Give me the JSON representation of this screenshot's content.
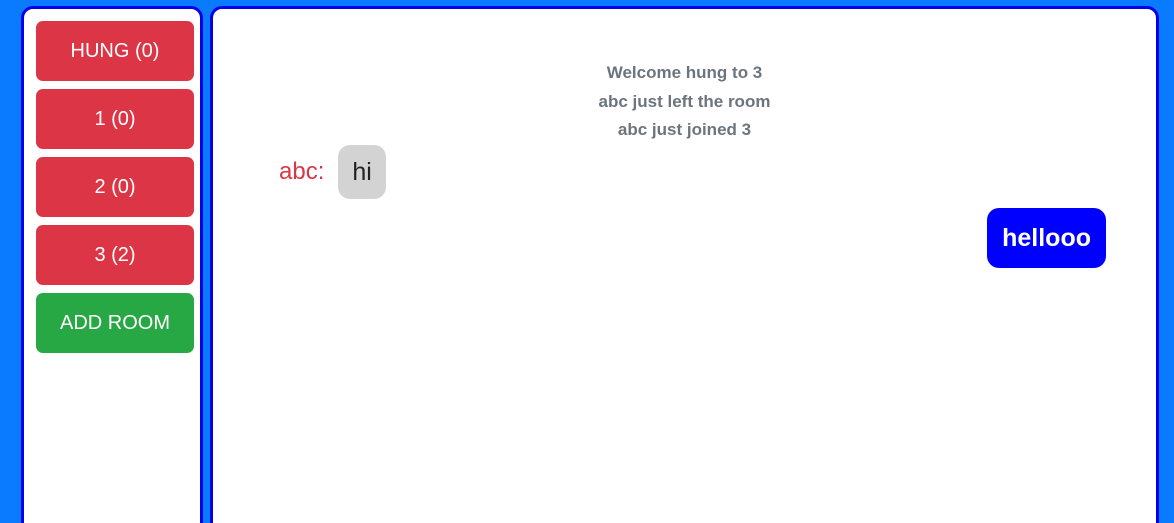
{
  "sidebar": {
    "rooms": [
      {
        "label": "HUNG (0)"
      },
      {
        "label": "1 (0)"
      },
      {
        "label": "2 (0)"
      },
      {
        "label": "3 (2)"
      }
    ],
    "add_room_label": "ADD ROOM"
  },
  "chat": {
    "system_messages": [
      "Welcome hung to 3",
      "abc just left the room",
      "abc just joined 3"
    ],
    "received": {
      "sender": "abc:",
      "text": "hi"
    },
    "sent": {
      "text": "hellooo"
    }
  },
  "colors": {
    "background": "#0a7bff",
    "panel_border": "#0000ee",
    "room_button": "#dc3545",
    "add_room_button": "#28a745",
    "sender_name": "#dc3545",
    "received_bubble": "#d3d3d3",
    "sent_bubble": "#0000ff",
    "system_text": "#6c757d"
  }
}
